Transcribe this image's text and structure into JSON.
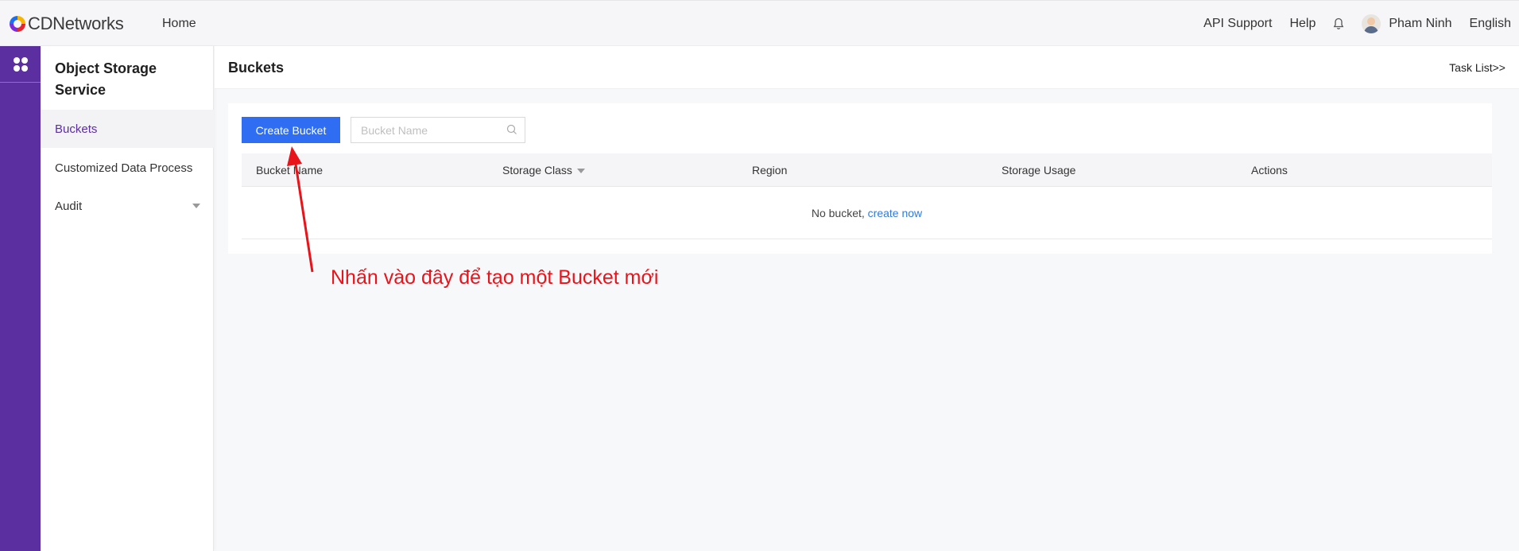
{
  "header": {
    "logo_text": "CDNetworks",
    "home": "Home",
    "api_support": "API Support",
    "help": "Help",
    "user_name": "Pham Ninh",
    "language": "English"
  },
  "sidebar": {
    "title": "Object Storage Service",
    "items": [
      {
        "label": "Buckets",
        "active": true
      },
      {
        "label": "Customized Data Process",
        "active": false
      },
      {
        "label": "Audit",
        "active": false
      }
    ]
  },
  "main": {
    "title": "Buckets",
    "task_list": "Task List>>",
    "create_button": "Create Bucket",
    "search_placeholder": "Bucket Name",
    "columns": [
      "Bucket Name",
      "Storage Class",
      "Region",
      "Storage Usage",
      "Actions"
    ],
    "empty_text": "No bucket,",
    "empty_link": "create now"
  },
  "annotation": {
    "text": "Nhấn vào đây để tạo một Bucket mới",
    "color": "#e8141b"
  },
  "colors": {
    "rail": "#5b2fa0",
    "primary_button": "#2f6ef2",
    "link": "#2f7bdc"
  }
}
